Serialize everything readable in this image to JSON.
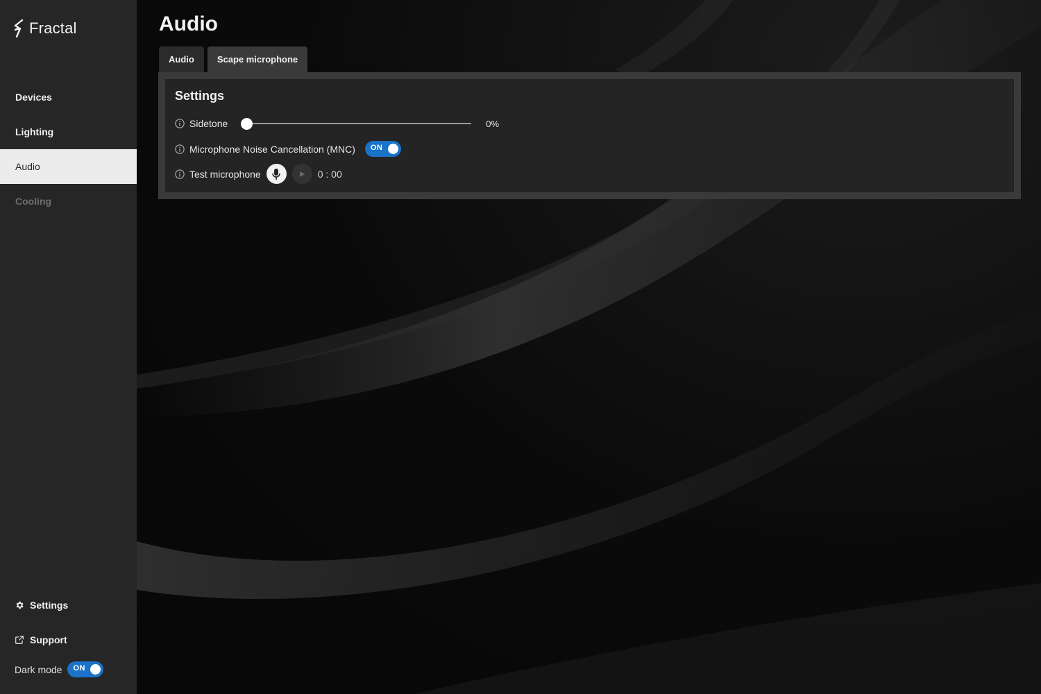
{
  "app": {
    "brand": "Fractal"
  },
  "sidebar": {
    "items": [
      {
        "label": "Devices",
        "state": "normal"
      },
      {
        "label": "Lighting",
        "state": "normal"
      },
      {
        "label": "Audio",
        "state": "active"
      },
      {
        "label": "Cooling",
        "state": "disabled"
      }
    ],
    "bottom": [
      {
        "label": "Settings",
        "icon": "gear-icon"
      },
      {
        "label": "Support",
        "icon": "external-link-icon"
      }
    ],
    "dark_mode": {
      "label": "Dark mode",
      "toggle_text": "ON",
      "enabled": true
    }
  },
  "main": {
    "title": "Audio",
    "tabs": [
      {
        "label": "Audio",
        "active": false
      },
      {
        "label": "Scape microphone",
        "active": true
      }
    ],
    "panel": {
      "title": "Settings",
      "sidetone": {
        "label": "Sidetone",
        "value": "0%",
        "level": 0
      },
      "mnc": {
        "label": "Microphone Noise Cancellation (MNC)",
        "toggle_text": "ON",
        "enabled": true
      },
      "test_mic": {
        "label": "Test microphone",
        "timer": "0 : 00"
      }
    }
  },
  "colors": {
    "accent": "#1a73c8",
    "sidebar_bg": "#262626",
    "active_nav_bg": "#ececec",
    "panel_bg": "#242424",
    "panel_border": "#3a3a3a"
  }
}
